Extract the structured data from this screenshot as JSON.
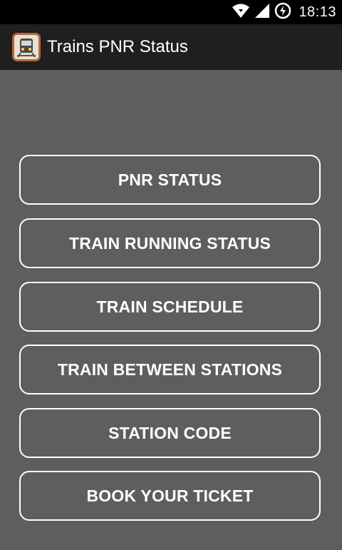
{
  "status_bar": {
    "time": "18:13",
    "icons": [
      "wifi-icon",
      "signal-icon",
      "sync-icon"
    ]
  },
  "action_bar": {
    "title": "Trains PNR Status",
    "icon": "train-app-icon"
  },
  "menu": {
    "items": [
      {
        "label": "PNR STATUS"
      },
      {
        "label": "TRAIN RUNNING STATUS"
      },
      {
        "label": "TRAIN SCHEDULE"
      },
      {
        "label": "TRAIN BETWEEN STATIONS"
      },
      {
        "label": "STATION CODE"
      },
      {
        "label": "BOOK YOUR TICKET"
      }
    ]
  },
  "colors": {
    "background": "#5e5e5e",
    "action_bar": "#1f1f1f",
    "status_bar": "#000000",
    "button_border": "#ffffff",
    "text": "#ffffff"
  }
}
